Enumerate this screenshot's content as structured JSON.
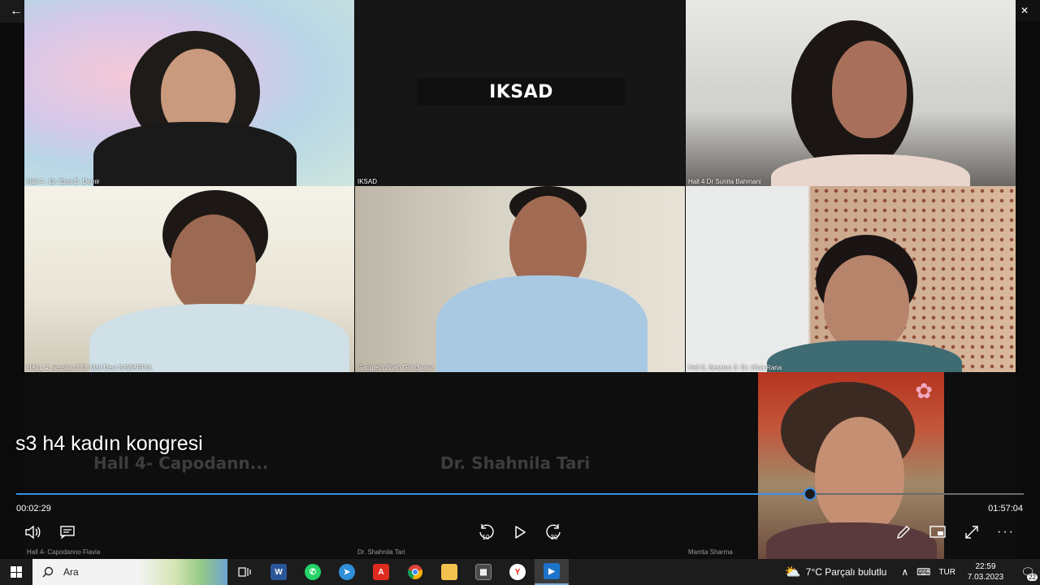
{
  "window": {
    "back_icon": "←",
    "minimize_icon": "—",
    "maximize_icon": "❐",
    "close_icon": "✕"
  },
  "tiles": [
    {
      "name": "Hall 4 - Dr. Esra E. Demir"
    },
    {
      "name": "IKSAD",
      "center_text": "IKSAD"
    },
    {
      "name": "Hall 4  Dr Sunita Bahmani"
    },
    {
      "name": "HALL 4, session 3 Dr Mali Devi SAWARIYA"
    },
    {
      "name": "Gangesh Shah Gondwana"
    },
    {
      "name": "Hall 6, Session 3- Dr. Hina Rana"
    }
  ],
  "bottom_row": {
    "ghost_1": "Hall  4-  Capodann...",
    "ghost_2": "Dr. Shahnila Tari",
    "label_1": "Hall 4- Capodanno Flavia",
    "label_2": "Dr. Shahnila Tari",
    "label_3": "Mamta Sharma"
  },
  "player": {
    "title": "s3 h4 kadın kongresi",
    "current_time": "00:02:29",
    "total_time": "01:57:04",
    "progress": 0.788,
    "rewind_label": "10",
    "forward_label": "30",
    "accent_color": "#3a8ee6"
  },
  "taskbar": {
    "search_placeholder": "Ara",
    "weather": "7°C  Parçalı bulutlu",
    "language": "TUR",
    "time": "22:59",
    "date": "7.03.2023",
    "notification_count": "22"
  }
}
